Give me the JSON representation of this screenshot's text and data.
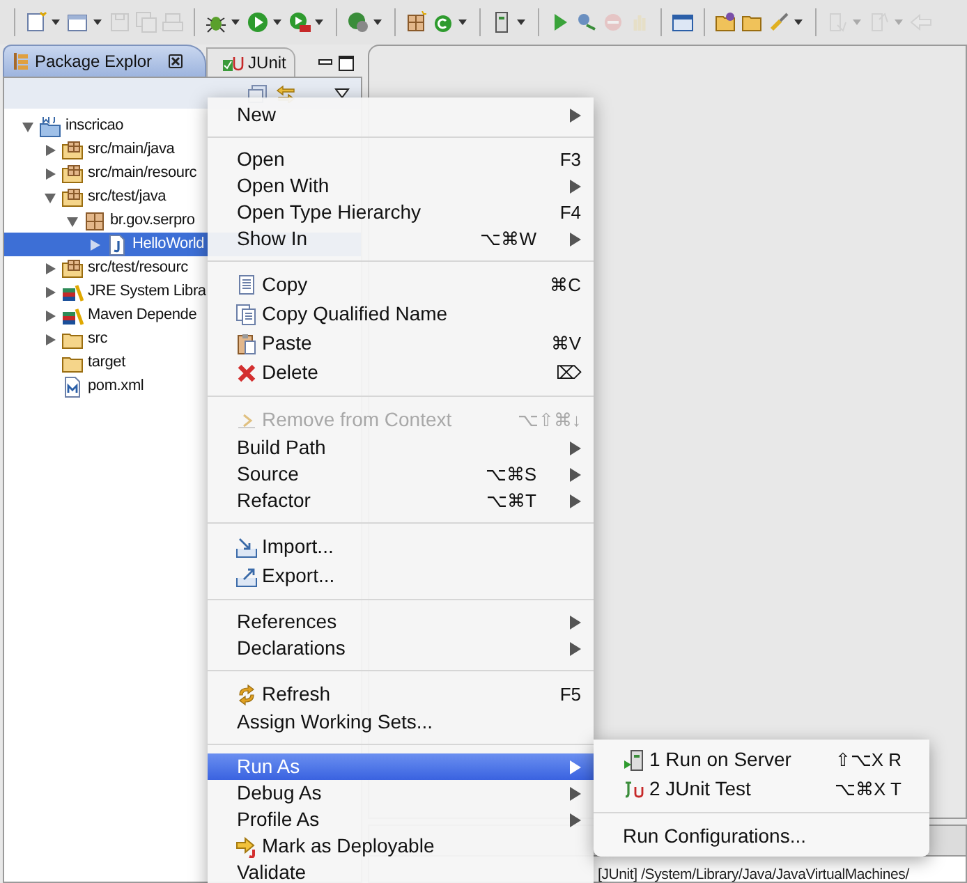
{
  "toolbar": {
    "items": [
      {
        "dropdown": true,
        "disabled": false
      },
      {
        "dropdown": true,
        "disabled": false
      },
      {
        "dropdown": false,
        "disabled": true
      },
      {
        "dropdown": false,
        "disabled": true
      },
      {
        "dropdown": false,
        "disabled": true
      },
      {
        "dropdown": true,
        "disabled": false
      },
      {
        "dropdown": true,
        "disabled": false
      },
      {
        "dropdown": true,
        "disabled": false
      },
      {
        "dropdown": true,
        "disabled": false
      },
      {
        "dropdown": false,
        "disabled": false
      },
      {
        "dropdown": true,
        "disabled": false
      },
      {
        "dropdown": true,
        "disabled": false
      },
      {
        "dropdown": false,
        "disabled": false
      },
      {
        "dropdown": false,
        "disabled": false
      },
      {
        "dropdown": false,
        "disabled": true
      },
      {
        "dropdown": false,
        "disabled": true
      },
      {
        "dropdown": false,
        "disabled": false
      },
      {
        "dropdown": false,
        "disabled": false
      },
      {
        "dropdown": false,
        "disabled": false
      },
      {
        "dropdown": true,
        "disabled": false
      },
      {
        "dropdown": true,
        "disabled": true
      },
      {
        "dropdown": true,
        "disabled": true
      },
      {
        "dropdown": false,
        "disabled": true
      }
    ]
  },
  "panel": {
    "tabs": [
      {
        "label": "Package Explor",
        "selected": true
      },
      {
        "label": "JUnit",
        "selected": false
      }
    ],
    "tree": [
      {
        "label": "inscricao",
        "kind": "project",
        "expanded": true,
        "selected": false,
        "children": [
          {
            "label": "src/main/java",
            "kind": "source-folder",
            "expanded": false,
            "selected": false
          },
          {
            "label": "src/main/resourc",
            "kind": "source-folder",
            "expanded": false,
            "selected": false
          },
          {
            "label": "src/test/java",
            "kind": "source-folder",
            "expanded": true,
            "selected": false,
            "children": [
              {
                "label": "br.gov.serpro",
                "kind": "package",
                "expanded": true,
                "selected": false,
                "children": [
                  {
                    "label": "HelloWorld",
                    "kind": "java-file",
                    "expanded": false,
                    "selected": true
                  }
                ]
              }
            ]
          },
          {
            "label": "src/test/resourc",
            "kind": "source-folder",
            "expanded": false,
            "selected": false
          },
          {
            "label": "JRE System Libra",
            "kind": "library",
            "expanded": false,
            "selected": false
          },
          {
            "label": "Maven Depende",
            "kind": "library",
            "expanded": false,
            "selected": false
          },
          {
            "label": "src",
            "kind": "folder",
            "expanded": false,
            "selected": false
          },
          {
            "label": "target",
            "kind": "leaf-folder",
            "selected": false
          },
          {
            "label": "pom.xml",
            "kind": "file",
            "selected": false
          }
        ]
      }
    ]
  },
  "context_menu": {
    "groups": [
      [
        {
          "label": "New",
          "has_submenu": true,
          "disabled": false,
          "selected": false
        }
      ],
      [
        {
          "label": "Open",
          "shortcut": "F3",
          "has_submenu": false,
          "disabled": false,
          "selected": false
        },
        {
          "label": "Open With",
          "has_submenu": true,
          "disabled": false,
          "selected": false
        },
        {
          "label": "Open Type Hierarchy",
          "shortcut": "F4",
          "has_submenu": false,
          "disabled": false,
          "selected": false
        },
        {
          "label": "Show In",
          "shortcut": "⌥⌘W",
          "has_submenu": true,
          "disabled": false,
          "selected": false
        }
      ],
      [
        {
          "label": "Copy",
          "shortcut": "⌘C",
          "has_submenu": false,
          "disabled": false,
          "selected": false
        },
        {
          "label": "Copy Qualified Name",
          "has_submenu": false,
          "disabled": false,
          "selected": false
        },
        {
          "label": "Paste",
          "shortcut": "⌘V",
          "has_submenu": false,
          "disabled": false,
          "selected": false
        },
        {
          "label": "Delete",
          "shortcut": "⌦",
          "has_submenu": false,
          "disabled": false,
          "selected": false
        }
      ],
      [
        {
          "label": "Remove from Context",
          "shortcut": "⌥⇧⌘↓",
          "has_submenu": false,
          "disabled": true,
          "selected": false
        },
        {
          "label": "Build Path",
          "has_submenu": true,
          "disabled": false,
          "selected": false
        },
        {
          "label": "Source",
          "shortcut": "⌥⌘S",
          "has_submenu": true,
          "disabled": false,
          "selected": false
        },
        {
          "label": "Refactor",
          "shortcut": "⌥⌘T",
          "has_submenu": true,
          "disabled": false,
          "selected": false
        }
      ],
      [
        {
          "label": "Import...",
          "has_submenu": false,
          "disabled": false,
          "selected": false
        },
        {
          "label": "Export...",
          "has_submenu": false,
          "disabled": false,
          "selected": false
        }
      ],
      [
        {
          "label": "References",
          "has_submenu": true,
          "disabled": false,
          "selected": false
        },
        {
          "label": "Declarations",
          "has_submenu": true,
          "disabled": false,
          "selected": false
        }
      ],
      [
        {
          "label": "Refresh",
          "shortcut": "F5",
          "has_submenu": false,
          "disabled": false,
          "selected": false
        },
        {
          "label": "Assign Working Sets...",
          "has_submenu": false,
          "disabled": false,
          "selected": false
        }
      ],
      [
        {
          "label": "Run As",
          "has_submenu": true,
          "disabled": false,
          "selected": true
        },
        {
          "label": "Debug As",
          "has_submenu": true,
          "disabled": false,
          "selected": false
        },
        {
          "label": "Profile As",
          "has_submenu": true,
          "disabled": false,
          "selected": false
        },
        {
          "label": "Mark as Deployable",
          "has_submenu": false,
          "disabled": false,
          "selected": false
        },
        {
          "label": "Validate",
          "has_submenu": false,
          "disabled": false,
          "selected": false
        }
      ]
    ]
  },
  "submenu": {
    "groups": [
      [
        {
          "label": "1 Run on Server",
          "shortcut": "⇧⌥X R"
        },
        {
          "label": "2 JUnit Test",
          "shortcut": "⌥⌘X T"
        }
      ],
      [
        {
          "label": "Run Configurations..."
        }
      ]
    ]
  },
  "status_bar": {
    "text": "[JUnit] /System/Library/Java/JavaVirtualMachines/"
  }
}
